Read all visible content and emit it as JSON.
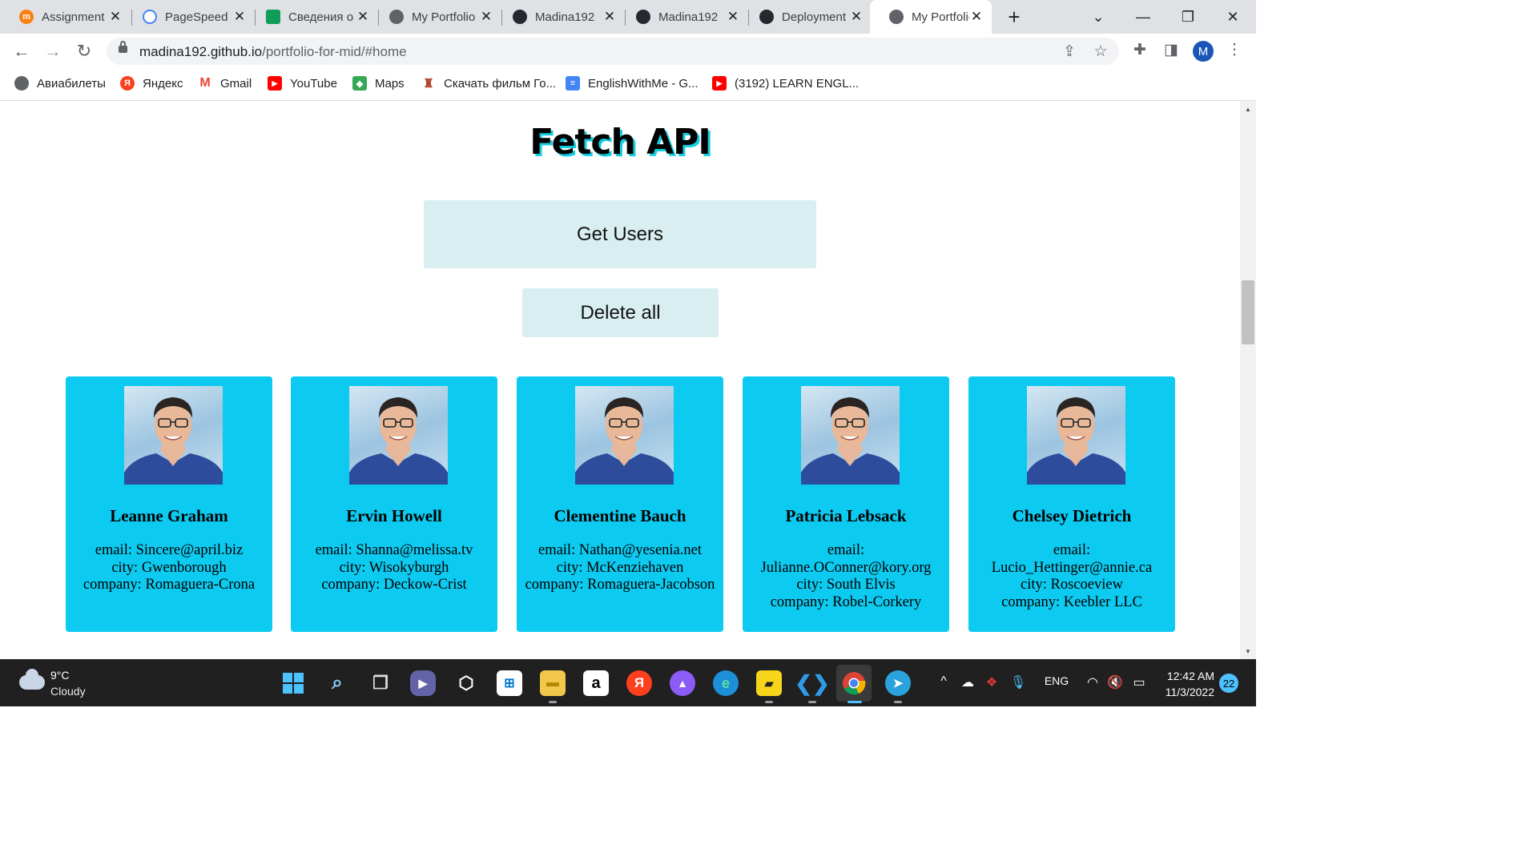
{
  "browser": {
    "tabs": [
      {
        "title": "Assignment",
        "icon": "moodle-icon",
        "color": "#f98012",
        "glyph": "m"
      },
      {
        "title": "PageSpeed",
        "icon": "pagespeed-icon",
        "color": "#4285f4",
        "glyph": "⌒"
      },
      {
        "title": "Сведения о",
        "icon": "sheet-icon",
        "color": "#f4b400",
        "glyph": "▣"
      },
      {
        "title": "My Portfolio",
        "icon": "globe-icon",
        "color": "#5f6368",
        "glyph": "◍"
      },
      {
        "title": "Madina192",
        "icon": "github-icon",
        "color": "#24292f",
        "glyph": "●"
      },
      {
        "title": "Madina192",
        "icon": "github-icon",
        "color": "#24292f",
        "glyph": "●"
      },
      {
        "title": "Deployment",
        "icon": "github-icon",
        "color": "#24292f",
        "glyph": "●"
      },
      {
        "title": "My Portfolio",
        "icon": "globe-icon",
        "color": "#5f6368",
        "glyph": "◍"
      }
    ],
    "url": {
      "domain": "madina192.github.io",
      "path": "/portfolio-for-mid/#home"
    },
    "profile_initial": "M",
    "bookmarks": [
      {
        "label": "Авиабилеты",
        "icon": "globe-icon",
        "color": "#5f6368",
        "glyph": "◍"
      },
      {
        "label": "Яндекс",
        "icon": "yandex-icon",
        "color": "#fc3f1d",
        "glyph": "Я"
      },
      {
        "label": "Gmail",
        "icon": "gmail-icon",
        "color": "#ea4335",
        "glyph": "M"
      },
      {
        "label": "YouTube",
        "icon": "youtube-icon",
        "color": "#ff0000",
        "glyph": "▶"
      },
      {
        "label": "Maps",
        "icon": "maps-icon",
        "color": "#34a853",
        "glyph": "◆"
      },
      {
        "label": "Скачать фильм Го...",
        "icon": "film-icon",
        "color": "#b0452b",
        "glyph": "♜"
      },
      {
        "label": "EnglishWithMe - G...",
        "icon": "docs-icon",
        "color": "#4285f4",
        "glyph": "≡"
      },
      {
        "label": "(3192) LEARN ENGL...",
        "icon": "youtube-icon",
        "color": "#ff0000",
        "glyph": "▶"
      }
    ]
  },
  "page": {
    "title": "Fetch API",
    "get_users_label": "Get Users",
    "delete_all_label": "Delete all",
    "users": [
      {
        "name": "Leanne Graham",
        "email_label": "email: Sincere@april.biz",
        "city": "city: Gwenborough",
        "company": "company: Romaguera-Crona"
      },
      {
        "name": "Ervin Howell",
        "email_label": "email: Shanna@melissa.tv",
        "city": "city: Wisokyburgh",
        "company": "company: Deckow-Crist"
      },
      {
        "name": "Clementine Bauch",
        "email_label": "email: Nathan@yesenia.net",
        "city": "city: McKenziehaven",
        "company": "company: Romaguera-Jacobson"
      },
      {
        "name": "Patricia Lebsack",
        "email_label": "email:",
        "email_value": "Julianne.OConner@kory.org",
        "city": "city: South Elvis",
        "company": "company: Robel-Corkery"
      },
      {
        "name": "Chelsey Dietrich",
        "email_label": "email:",
        "email_value": "Lucio_Hettinger@annie.ca",
        "city": "city: Roscoeview",
        "company": "company: Keebler LLC"
      }
    ],
    "colors": {
      "card": "#0dcaf0",
      "button": "#d9eef0",
      "title_shadow": "#14cce2"
    }
  },
  "taskbar": {
    "weather": {
      "temp": "9°C",
      "desc": "Cloudy"
    },
    "language": "ENG",
    "time": "12:42 AM",
    "date": "11/3/2022",
    "notifications": "22"
  }
}
